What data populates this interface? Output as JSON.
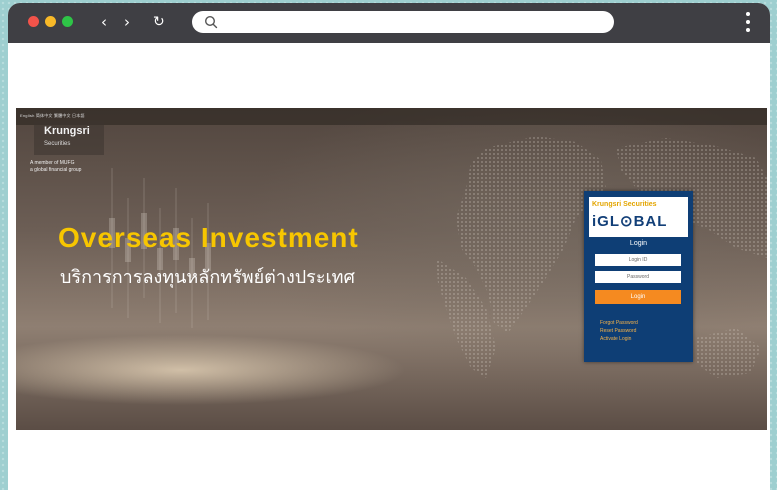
{
  "browser": {
    "nav_back": "‹",
    "nav_forward": "›",
    "nav_reload": "↻",
    "address_value": "",
    "traffic_colors": {
      "close": "#f2534a",
      "minimize": "#f8b928",
      "maximize": "#2ec447"
    },
    "icons": [
      "search-icon",
      "more-vertical-icon"
    ]
  },
  "page": {
    "language_links": "English 简体中文 繁體中文 日本語",
    "bank": {
      "name": "Krungsri",
      "subname": "Securities",
      "member_line1": "A member of MUFG",
      "member_line2": "a global financial group"
    },
    "headline": "Overseas Investment",
    "subheadline": "บริการการลงทุนหลักทรัพย์ต่างประเทศ",
    "accent_color": "#f7c600"
  },
  "login": {
    "brand_top": "Krungsri Securities",
    "brand_main": "iGL⊙BAL",
    "title": "Login",
    "username_placeholder": "Login ID",
    "password_placeholder": "Password",
    "submit_label": "Login",
    "links": {
      "forgot": "Forgot Password",
      "reset": "Reset Password",
      "activate": "Activate Login"
    },
    "panel_color": "#0e3e75",
    "button_color": "#f58a20"
  }
}
